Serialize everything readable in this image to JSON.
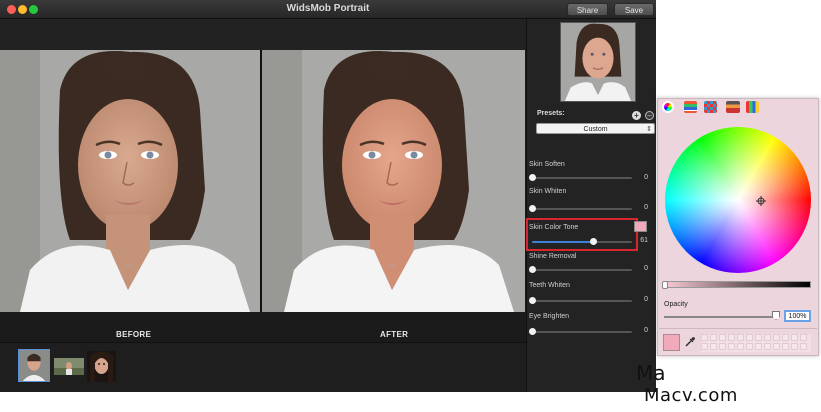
{
  "window": {
    "title": "WidsMob Portrait",
    "share_label": "Share",
    "save_label": "Save"
  },
  "compare": {
    "before_label": "BEFORE",
    "after_label": "AFTER"
  },
  "presets": {
    "label": "Presets:",
    "selected": "Custom",
    "add_icon": "plus-circle-icon",
    "remove_icon": "minus-circle-icon"
  },
  "adjustments": [
    {
      "label": "Skin Soften",
      "value": "0",
      "level": 0
    },
    {
      "label": "Skin Whiten",
      "value": "0",
      "level": 0
    },
    {
      "label": "Skin Color Tone",
      "value": "61",
      "level": 0.61
    },
    {
      "label": "Shine Removal",
      "value": "0",
      "level": 0
    },
    {
      "label": "Teeth Whiten",
      "value": "0",
      "level": 0
    },
    {
      "label": "Eye Brighten",
      "value": "0",
      "level": 0
    }
  ],
  "color_picker": {
    "tabs": [
      "color-wheel-icon",
      "color-sliders-icon",
      "color-palettes-icon",
      "image-palettes-icon",
      "crayons-icon"
    ],
    "opacity_label": "Opacity",
    "opacity_value": "100%",
    "opacity_level": 1.0,
    "selected_color": "#f2a9b9"
  },
  "watermark": {
    "line1": "Ma",
    "line2": "Macv.com"
  },
  "colors": {
    "accent": "#3b82d8",
    "highlight": "#d8262e",
    "window_bg": "#1c1c1c"
  }
}
